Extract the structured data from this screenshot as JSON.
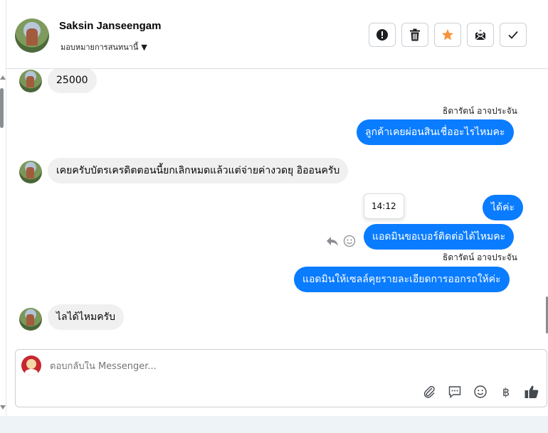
{
  "header": {
    "contact_name": "Saksin Janseengam",
    "assign_label": "มอบหมายการสนทนานี้",
    "actions": [
      "mark-spam",
      "delete",
      "star",
      "mark-unread",
      "done"
    ]
  },
  "messages": [
    {
      "dir": "in",
      "text": "25000"
    },
    {
      "dir": "out",
      "sender": "ธิดารัตน์ อาจประจัน",
      "text": "ลูกค้าเคยผ่อนสินเชื่ออะไรไหมคะ"
    },
    {
      "dir": "in",
      "text": "เคยครับบัตรเครดิตตอนนี้ยกเลิกหมดแล้วแต่จ่ายค่างวดยุ  อิออนครับ"
    },
    {
      "dir": "out",
      "text": "ได้ค่ะ"
    },
    {
      "dir": "out",
      "text": "แอดมินขอเบอร์ติดต่อได้ไหมคะ"
    },
    {
      "dir": "out",
      "sender": "ธิดารัตน์ อาจประจัน",
      "text": "แอดมินให้เซลล์คุยรายละเอียดการออกรถให้ค่ะ"
    },
    {
      "dir": "in",
      "text": "ไลได้ไหมครับ"
    }
  ],
  "tooltip_time": "14:12",
  "composer": {
    "placeholder": "ตอบกลับใน Messenger...",
    "tools": [
      "attachment-icon",
      "saved-reply-icon",
      "emoji-icon",
      "baht-icon",
      "like-icon"
    ],
    "baht_symbol": "฿"
  },
  "colors": {
    "outgoing": "#0a7cff",
    "incoming": "#f0f0f0",
    "star": "#f7923b"
  }
}
